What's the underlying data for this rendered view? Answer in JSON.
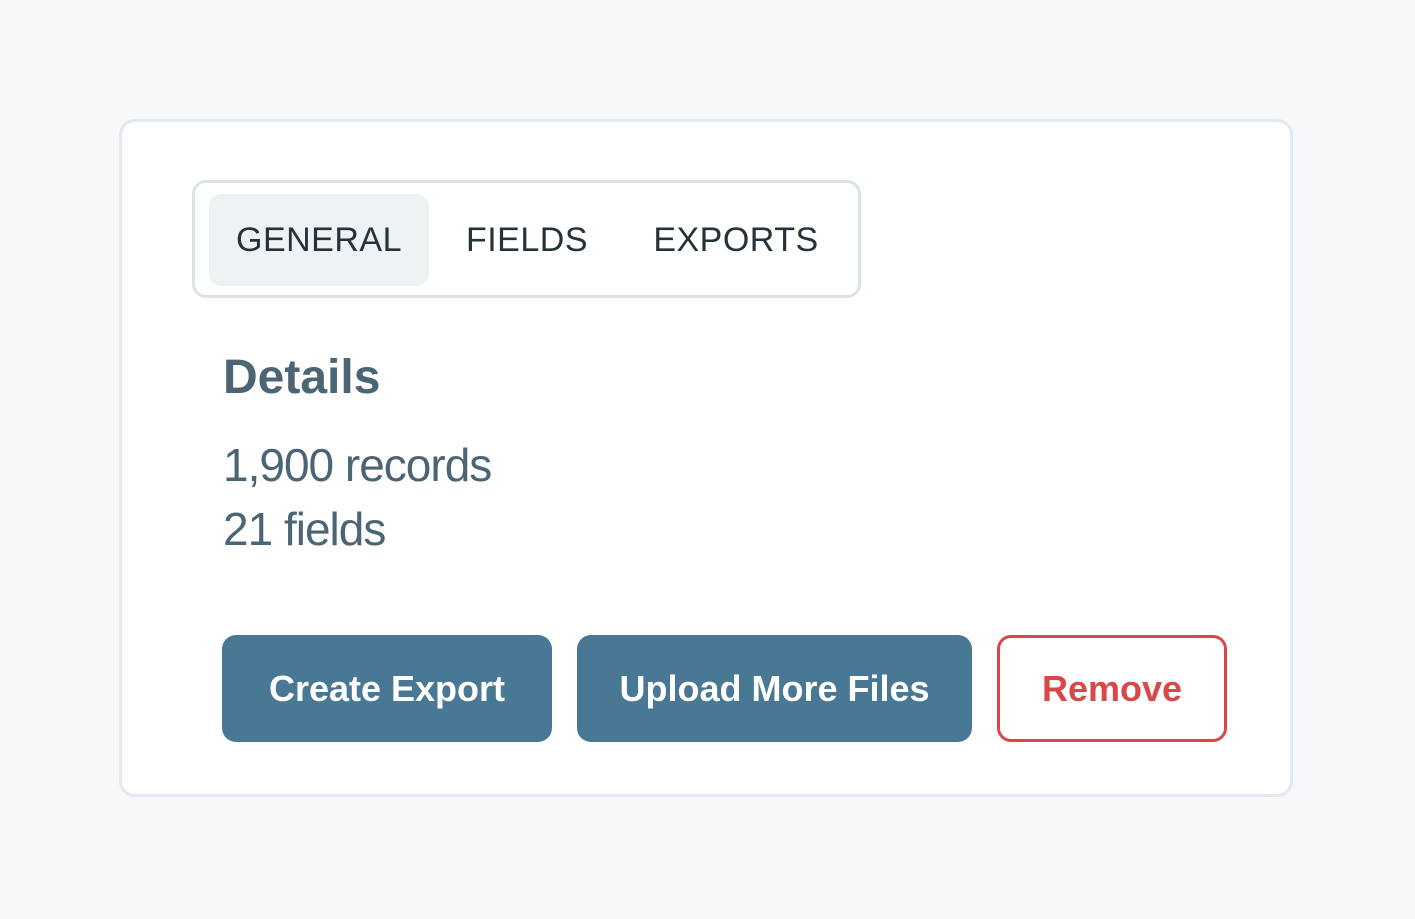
{
  "tabs": [
    {
      "label": "GENERAL",
      "active": true
    },
    {
      "label": "FIELDS",
      "active": false
    },
    {
      "label": "EXPORTS",
      "active": false
    }
  ],
  "details": {
    "title": "Details",
    "records": "1,900 records",
    "fields": "21 fields"
  },
  "actions": {
    "create_export": "Create Export",
    "upload_more_files": "Upload More Files",
    "remove": "Remove"
  },
  "colors": {
    "primary": "#497895",
    "danger": "#d94848",
    "text": "#4b6575",
    "background": "#f6f8fa"
  }
}
